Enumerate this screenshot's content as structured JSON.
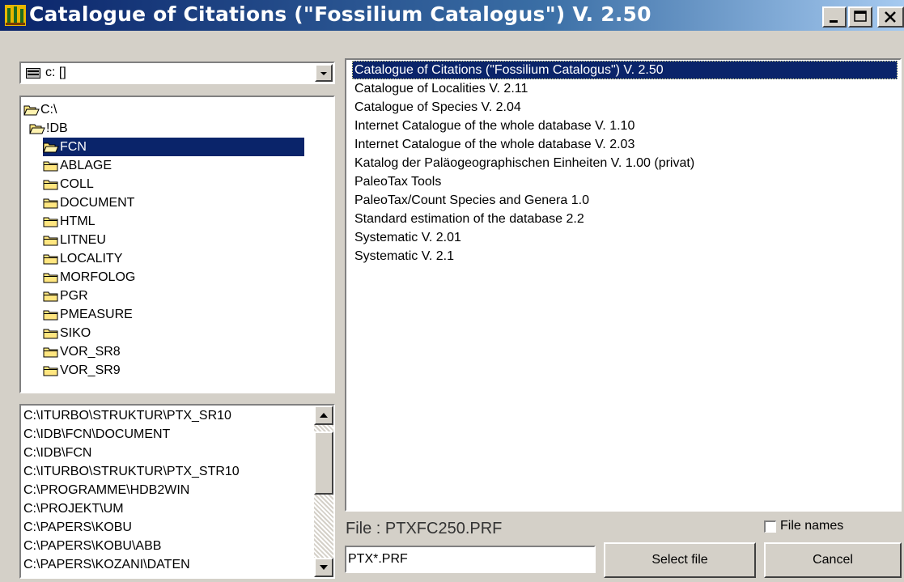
{
  "window": {
    "title": "Catalogue of Citations (\"Fossilium Catalogus\") V. 2.50",
    "icon": "app-logo-icon",
    "controls": [
      "minimize-icon",
      "maximize-icon",
      "close-icon"
    ]
  },
  "drive": {
    "value": "c: []",
    "icon": "drive-icon"
  },
  "directory_tree": {
    "items": [
      {
        "label": "C:\\",
        "icon": "open-folder-icon",
        "selected": false
      },
      {
        "label": "!DB",
        "icon": "open-folder-icon",
        "selected": false
      },
      {
        "label": "FCN",
        "icon": "open-folder-icon",
        "selected": true
      },
      {
        "label": "ABLAGE",
        "icon": "folder-icon",
        "selected": false
      },
      {
        "label": "COLL",
        "icon": "folder-icon",
        "selected": false
      },
      {
        "label": "DOCUMENT",
        "icon": "folder-icon",
        "selected": false
      },
      {
        "label": "HTML",
        "icon": "folder-icon",
        "selected": false
      },
      {
        "label": "LITNEU",
        "icon": "folder-icon",
        "selected": false
      },
      {
        "label": "LOCALITY",
        "icon": "folder-icon",
        "selected": false
      },
      {
        "label": "MORFOLOG",
        "icon": "folder-icon",
        "selected": false
      },
      {
        "label": "PGR",
        "icon": "folder-icon",
        "selected": false
      },
      {
        "label": "PMEASURE",
        "icon": "folder-icon",
        "selected": false
      },
      {
        "label": "SIKO",
        "icon": "folder-icon",
        "selected": false
      },
      {
        "label": "VOR_SR8",
        "icon": "folder-icon",
        "selected": false
      },
      {
        "label": "VOR_SR9",
        "icon": "folder-icon",
        "selected": false
      }
    ]
  },
  "history": {
    "items": [
      "C:\\ITURBO\\STRUKTUR\\PTX_SR10",
      "C:\\IDB\\FCN\\DOCUMENT",
      "C:\\IDB\\FCN",
      "C:\\ITURBO\\STRUKTUR\\PTX_STR10",
      "C:\\PROGRAMME\\HDB2WIN",
      "C:\\PROJEKT\\UM",
      "C:\\PAPERS\\KOBU",
      "C:\\PAPERS\\KOBU\\ABB",
      "C:\\PAPERS\\KOZANI\\DATEN"
    ]
  },
  "programs": {
    "items": [
      {
        "label": "Catalogue of Citations (\"Fossilium Catalogus\") V. 2.50",
        "selected": true
      },
      {
        "label": "Catalogue of Localities V. 2.11",
        "selected": false
      },
      {
        "label": "Catalogue of Species V. 2.04",
        "selected": false
      },
      {
        "label": "Internet Catalogue of the whole database V. 1.10",
        "selected": false
      },
      {
        "label": "Internet Catalogue of the whole database V. 2.03",
        "selected": false
      },
      {
        "label": "Katalog der Paläogeographischen Einheiten V. 1.00 (privat)",
        "selected": false
      },
      {
        "label": "PaleoTax Tools",
        "selected": false
      },
      {
        "label": "PaleoTax/Count Species and Genera 1.0",
        "selected": false
      },
      {
        "label": "Standard estimation of the database 2.2",
        "selected": false
      },
      {
        "label": "Systematic V. 2.01",
        "selected": false
      },
      {
        "label": "Systematic V. 2.1",
        "selected": false
      }
    ]
  },
  "file": {
    "label": "File : PTXFC250.PRF",
    "filter_value": "PTX*.PRF"
  },
  "checkbox": {
    "label": "File names",
    "checked": false
  },
  "buttons": {
    "select": "Select file",
    "cancel": "Cancel"
  },
  "colors": {
    "titlebar_start": "#0a246a",
    "titlebar_end": "#a6caf0",
    "selection": "#0a246a",
    "face": "#d4d0c8"
  }
}
